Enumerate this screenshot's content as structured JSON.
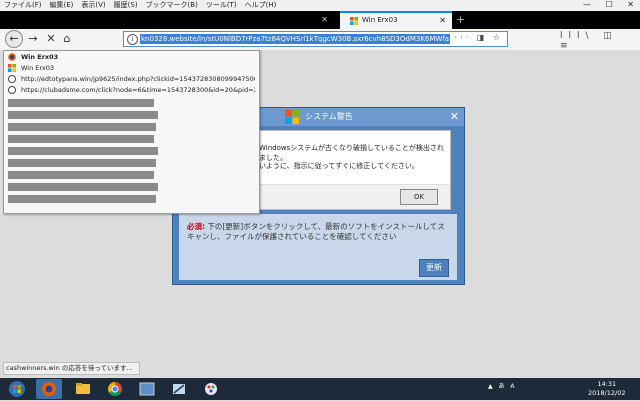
{
  "menubar": {
    "items": [
      "ファイル(F)",
      "編集(E)",
      "表示(V)",
      "履歴(S)",
      "ブックマーク(B)",
      "ツール(T)",
      "ヘルプ(H)"
    ]
  },
  "window_controls": [
    "—",
    "☐",
    "✕"
  ],
  "tabs": {
    "active_label": "Win Erx03",
    "new_tab": "+"
  },
  "toolbar": {
    "url": "kn0328.website/ln/stU0NlBD7rPza7tz84QVHSrl1kTqgcW30B.sxr6cvh8SD3OdM3K6MWfa",
    "url_tools": "··· ◨ ☆",
    "right_tools": "lll\\ ◫ ≡"
  },
  "dropdown": {
    "rows": [
      {
        "text": "Win Erx03",
        "bold": true,
        "icon": "firefox-icon"
      },
      {
        "text": "Win Erx03",
        "bold": false,
        "icon": "windows-icon"
      },
      {
        "text": "http://edtotypans.win/jp9625/index.php?clickid=1543728308099947506...",
        "bold": false,
        "icon": "globe-icon"
      },
      {
        "text": "https://clubadsme.com/click?node=6&time=1543728300&id=20&pid=2...",
        "bold": false,
        "icon": "globe-icon"
      }
    ]
  },
  "warning_dialog": {
    "title": "システム警告",
    "close": "✕",
    "bold_prefix": "必須:",
    "body_text": " 下の[更新]ボタンをクリックして、最新のソフトをインストールしてスキャンし、ファイルが保護されていることを確認してください",
    "update_button": "更新"
  },
  "alert_box": {
    "line1": "Windowsシステムが古くなり破損していることが検出されました。",
    "line2": "いように、指示に従ってすぐに修正してください。",
    "ok_button": "OK"
  },
  "status": {
    "text": "cashwinners.win の応答を待っています..."
  },
  "taskbar": {
    "tray": "▲ あ A",
    "time": "14:31",
    "date": "2018/12/02"
  },
  "colors": {
    "accent": "#0a84ff",
    "dialog_blue": "#4f81bd",
    "taskbar": "#1c2a3a"
  }
}
